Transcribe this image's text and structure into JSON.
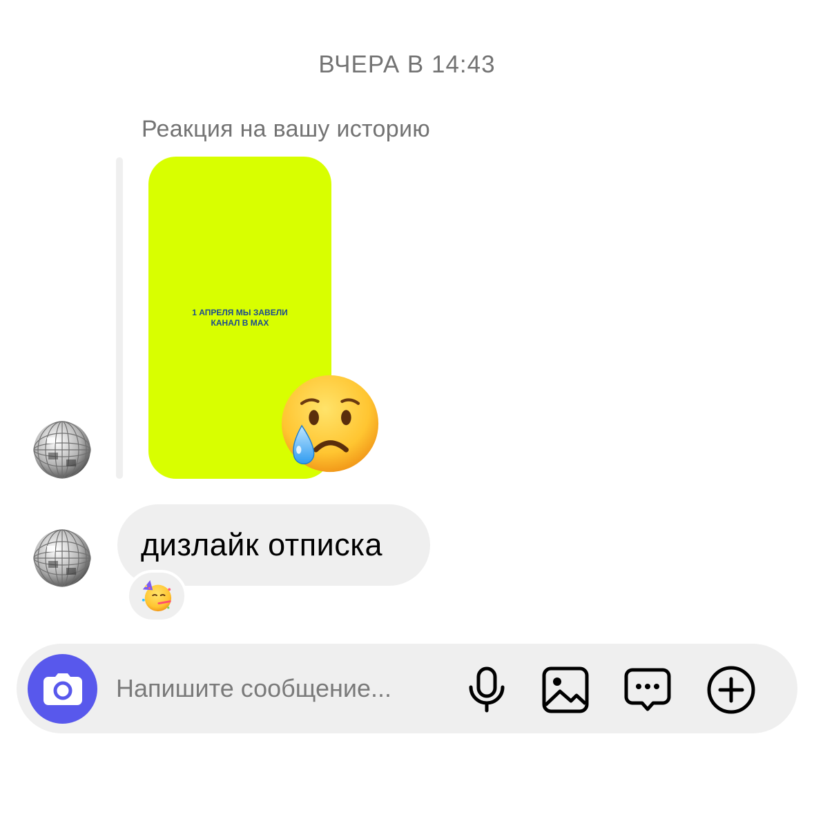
{
  "chat": {
    "timestamp": "ВЧЕРА В 14:43",
    "story_reply": {
      "caption": "Реакция на вашу историю",
      "story_text": "1 АПРЕЛЯ МЫ ЗАВЕЛИ\nКАНАЛ В MAX",
      "story_color": "#d8ff00",
      "reaction_emoji": "crying-face"
    },
    "message": {
      "text": "дизлайк отписка",
      "reaction_emoji": "partying-face"
    },
    "sender_avatar": "disco-ball"
  },
  "composer": {
    "placeholder": "Напишите сообщение...",
    "camera_color": "#5858ec",
    "icons": [
      "camera-icon",
      "microphone-icon",
      "gallery-icon",
      "sticker-icon",
      "plus-icon"
    ]
  }
}
